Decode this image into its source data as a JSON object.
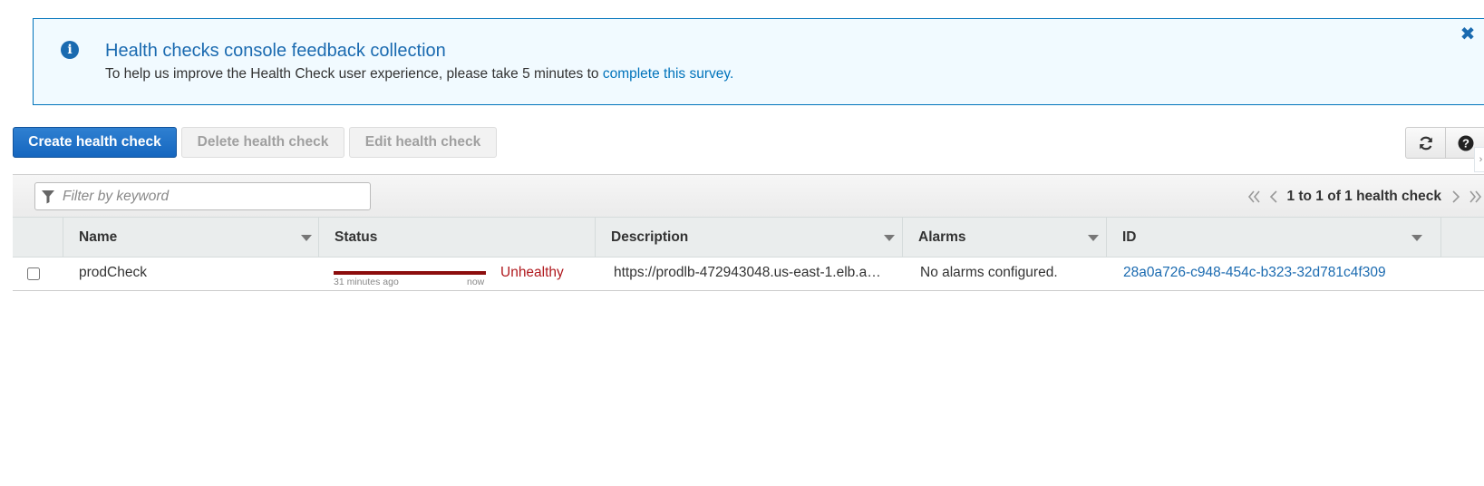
{
  "banner": {
    "title": "Health checks console feedback collection",
    "body_text": "To help us improve the Health Check user experience, please take 5 minutes to ",
    "link_text": "complete this survey.",
    "close_glyph": "✖",
    "info_glyph": "i"
  },
  "toolbar": {
    "create_label": "Create health check",
    "delete_label": "Delete health check",
    "edit_label": "Edit health check"
  },
  "filter": {
    "placeholder": "Filter by keyword"
  },
  "pagination": {
    "text": "1 to 1 of 1 health check"
  },
  "table": {
    "columns": [
      "Name",
      "Status",
      "Description",
      "Alarms",
      "ID"
    ],
    "rows": [
      {
        "name": "prodCheck",
        "status_since": "31 minutes ago",
        "status_now": "now",
        "status": "Unhealthy",
        "description": "https://prodlb-472943048.us-east-1.elb.a…",
        "alarms": "No alarms configured.",
        "id": "28a0a726-c948-454c-b323-32d781c4f309"
      }
    ]
  },
  "colors": {
    "primary": "#1566bf",
    "link": "#1a6ab0",
    "unhealthy": "#b0191e",
    "status_bar": "#8c0d0d",
    "banner_bg": "#f1faff"
  },
  "icons": {
    "info": "info-icon",
    "close": "close-icon",
    "refresh": "refresh-icon",
    "help": "help-icon",
    "filter": "filter-icon",
    "first": "first-page-icon",
    "prev": "previous-page-icon",
    "next": "next-page-icon",
    "last": "last-page-icon"
  }
}
